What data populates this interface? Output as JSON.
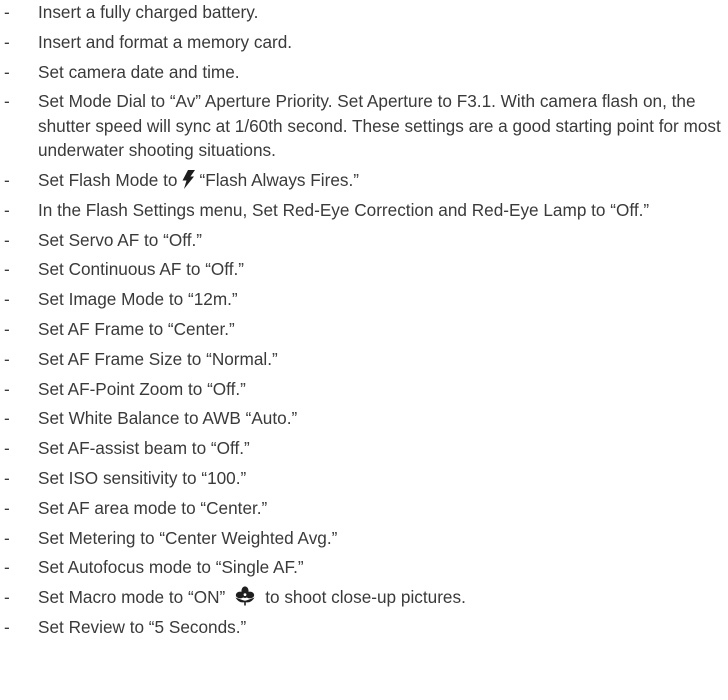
{
  "colors": {
    "text": "#3a3a3a",
    "icon": "#1e1e1e"
  },
  "bullet": "-",
  "items": [
    {
      "text": "Insert a fully charged battery."
    },
    {
      "text": "Insert and format a memory card."
    },
    {
      "text": "Set camera date and time."
    },
    {
      "text": "Set Mode Dial to “Av” Aperture Priority. Set Aperture to F3.1. With camera flash on, the shutter speed will sync at 1/60th second. These settings are a good starting point for most underwater shooting situations."
    },
    {
      "before": "Set Flash Mode to",
      "icon": "flash-icon",
      "after": "“Flash Always Fires.”"
    },
    {
      "text": "In the Flash Settings menu, Set Red-Eye Correction and Red-Eye Lamp to “Off.”"
    },
    {
      "text": "Set Servo AF to “Off.”"
    },
    {
      "text": "Set Continuous AF to “Off.”"
    },
    {
      "text": "Set Image Mode to “12m.”"
    },
    {
      "text": "Set AF Frame to “Center.”"
    },
    {
      "text": "Set AF Frame Size to “Normal.”"
    },
    {
      "text": "Set AF-Point Zoom to “Off.”"
    },
    {
      "text": "Set White Balance to AWB “Auto.”"
    },
    {
      "text": "Set AF-assist beam to “Off.”"
    },
    {
      "text": "Set ISO sensitivity to “100.”"
    },
    {
      "text": "Set AF area mode to “Center.”"
    },
    {
      "text": "Set Metering to “Center Weighted Avg.”"
    },
    {
      "text": "Set Autofocus mode to “Single AF.”"
    },
    {
      "before": "Set Macro mode to “ON”",
      "icon": "macro-flower-icon",
      "after": "to shoot close-up pictures."
    },
    {
      "text": "Set Review to “5 Seconds.”"
    }
  ]
}
